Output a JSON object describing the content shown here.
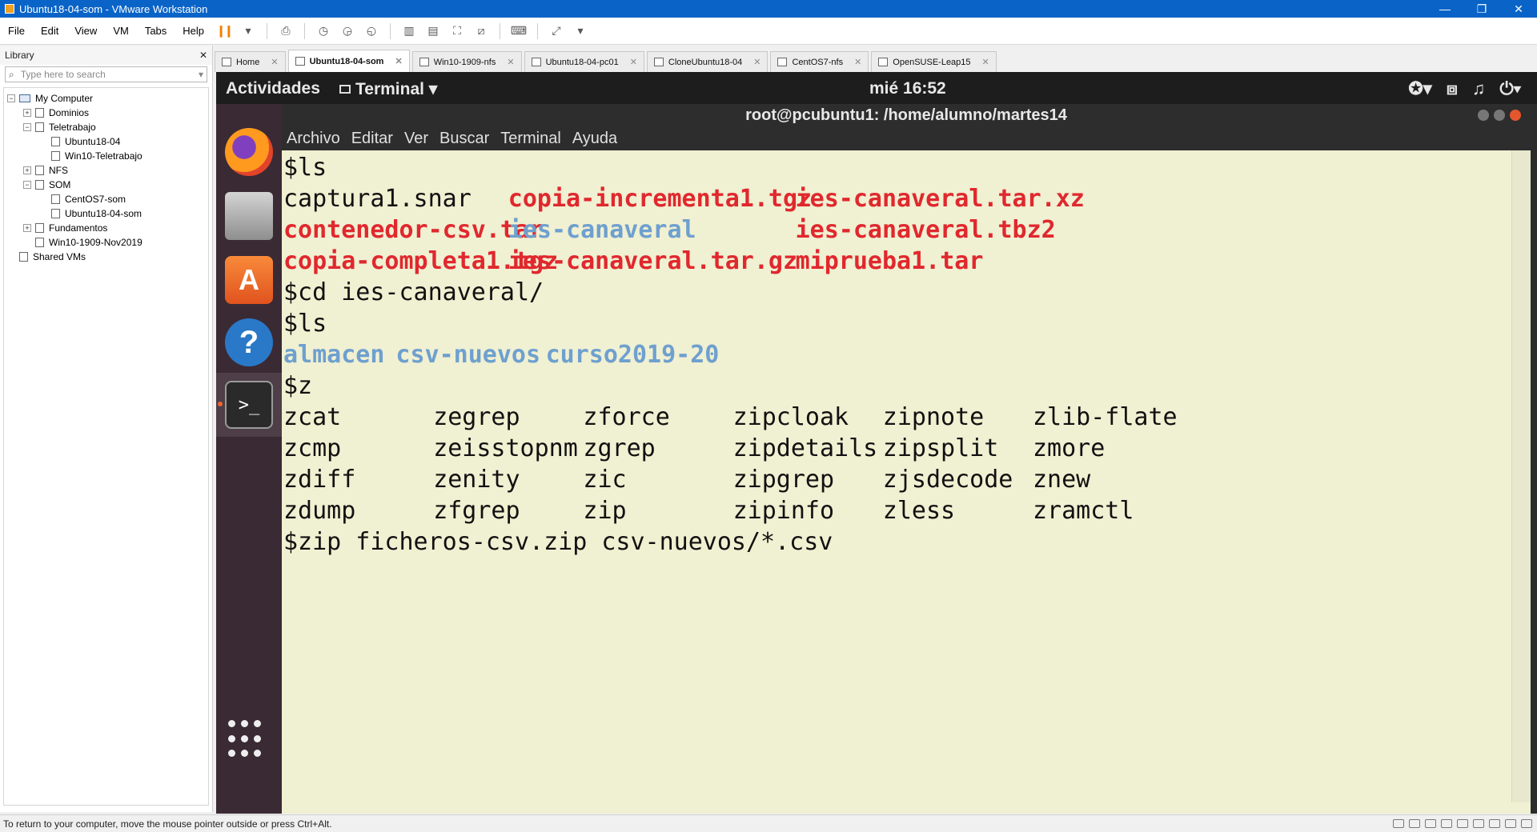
{
  "window": {
    "title": "Ubuntu18-04-som - VMware Workstation",
    "minimize": "—",
    "restore": "❐",
    "close": "✕"
  },
  "menu": [
    "File",
    "Edit",
    "View",
    "VM",
    "Tabs",
    "Help"
  ],
  "library": {
    "title": "Library",
    "close": "✕",
    "search_placeholder": "Type here to search",
    "tree": [
      {
        "label": "My Computer",
        "level": 0,
        "expander": "−",
        "icon": "pc"
      },
      {
        "label": "Dominios",
        "level": 1,
        "expander": "+",
        "icon": "folder"
      },
      {
        "label": "Teletrabajo",
        "level": 1,
        "expander": "−",
        "icon": "folder"
      },
      {
        "label": "Ubuntu18-04",
        "level": 2,
        "expander": "",
        "icon": "vm"
      },
      {
        "label": "Win10-Teletrabajo",
        "level": 2,
        "expander": "",
        "icon": "vm"
      },
      {
        "label": "NFS",
        "level": 1,
        "expander": "+",
        "icon": "folder"
      },
      {
        "label": "SOM",
        "level": 1,
        "expander": "−",
        "icon": "folder"
      },
      {
        "label": "CentOS7-som",
        "level": 2,
        "expander": "",
        "icon": "vm"
      },
      {
        "label": "Ubuntu18-04-som",
        "level": 2,
        "expander": "",
        "icon": "vm"
      },
      {
        "label": "Fundamentos",
        "level": 1,
        "expander": "+",
        "icon": "folder"
      },
      {
        "label": "Win10-1909-Nov2019",
        "level": 1,
        "expander": "",
        "icon": "vm"
      },
      {
        "label": "Shared VMs",
        "level": 0,
        "expander": "",
        "icon": "shared"
      }
    ]
  },
  "tabs": [
    {
      "label": "Home",
      "active": false
    },
    {
      "label": "Ubuntu18-04-som",
      "active": true
    },
    {
      "label": "Win10-1909-nfs",
      "active": false
    },
    {
      "label": "Ubuntu18-04-pc01",
      "active": false
    },
    {
      "label": "CloneUbuntu18-04",
      "active": false
    },
    {
      "label": "CentOS7-nfs",
      "active": false
    },
    {
      "label": "OpenSUSE-Leap15",
      "active": false
    }
  ],
  "guest": {
    "activities": "Actividades",
    "app_menu": "Terminal ▾",
    "clock": "mié 16:52",
    "sys_icons": [
      "accessibility-icon",
      "network-icon",
      "volume-icon",
      "power-icon"
    ]
  },
  "terminal": {
    "title": "root@pcubuntu1: /home/alumno/martes14",
    "menu": [
      "Archivo",
      "Editar",
      "Ver",
      "Buscar",
      "Terminal",
      "Ayuda"
    ],
    "lines": [
      [
        {
          "t": "$ls",
          "col": 0,
          "cls": ""
        }
      ],
      [
        {
          "t": "captura1.snar",
          "col": 0,
          "cls": ""
        },
        {
          "t": "copia-incrementa1.tgz",
          "col": 18,
          "cls": "red"
        },
        {
          "t": "ies-canaveral.tar.xz",
          "col": 41,
          "cls": "red"
        }
      ],
      [
        {
          "t": "contenedor-csv.tar",
          "col": 0,
          "cls": "red"
        },
        {
          "t": "ies-canaveral",
          "col": 18,
          "cls": "blue"
        },
        {
          "t": "ies-canaveral.tbz2",
          "col": 41,
          "cls": "red"
        }
      ],
      [
        {
          "t": "copia-completa1.tgz",
          "col": 0,
          "cls": "red"
        },
        {
          "t": "ies-canaveral.tar.gz",
          "col": 18,
          "cls": "red"
        },
        {
          "t": "miprueba1.tar",
          "col": 41,
          "cls": "red"
        }
      ],
      [
        {
          "t": "$cd ies-canaveral/",
          "col": 0,
          "cls": ""
        }
      ],
      [
        {
          "t": "$ls",
          "col": 0,
          "cls": ""
        }
      ],
      [
        {
          "t": "almacen",
          "col": 0,
          "cls": "blue"
        },
        {
          "t": "csv-nuevos",
          "col": 9,
          "cls": "blue"
        },
        {
          "t": "curso2019-20",
          "col": 21,
          "cls": "blue"
        }
      ],
      [
        {
          "t": "$z",
          "col": 0,
          "cls": ""
        }
      ],
      [
        {
          "t": "zcat",
          "col": 0,
          "cls": ""
        },
        {
          "t": "zegrep",
          "col": 12,
          "cls": ""
        },
        {
          "t": "zforce",
          "col": 24,
          "cls": ""
        },
        {
          "t": "zipcloak",
          "col": 36,
          "cls": ""
        },
        {
          "t": "zipnote",
          "col": 48,
          "cls": ""
        },
        {
          "t": "zlib-flate",
          "col": 60,
          "cls": ""
        }
      ],
      [
        {
          "t": "zcmp",
          "col": 0,
          "cls": ""
        },
        {
          "t": "zeisstopnm",
          "col": 12,
          "cls": ""
        },
        {
          "t": "zgrep",
          "col": 24,
          "cls": ""
        },
        {
          "t": "zipdetails",
          "col": 36,
          "cls": ""
        },
        {
          "t": "zipsplit",
          "col": 48,
          "cls": ""
        },
        {
          "t": "zmore",
          "col": 60,
          "cls": ""
        }
      ],
      [
        {
          "t": "zdiff",
          "col": 0,
          "cls": ""
        },
        {
          "t": "zenity",
          "col": 12,
          "cls": ""
        },
        {
          "t": "zic",
          "col": 24,
          "cls": ""
        },
        {
          "t": "zipgrep",
          "col": 36,
          "cls": ""
        },
        {
          "t": "zjsdecode",
          "col": 48,
          "cls": ""
        },
        {
          "t": "znew",
          "col": 60,
          "cls": ""
        }
      ],
      [
        {
          "t": "zdump",
          "col": 0,
          "cls": ""
        },
        {
          "t": "zfgrep",
          "col": 12,
          "cls": ""
        },
        {
          "t": "zip",
          "col": 24,
          "cls": ""
        },
        {
          "t": "zipinfo",
          "col": 36,
          "cls": ""
        },
        {
          "t": "zless",
          "col": 48,
          "cls": ""
        },
        {
          "t": "zramctl",
          "col": 60,
          "cls": ""
        }
      ],
      [
        {
          "t": "$zip ficheros-csv.zip csv-nuevos/*.csv",
          "col": 0,
          "cls": ""
        }
      ]
    ]
  },
  "status_message": "To return to your computer, move the mouse pointer outside or press Ctrl+Alt."
}
